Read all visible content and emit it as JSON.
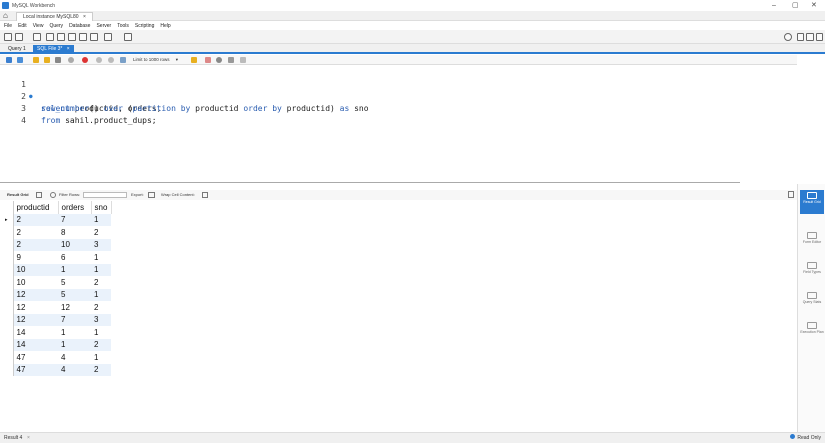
{
  "window": {
    "title": "MySQL Workbench",
    "minimize": "–",
    "maximize": "▢",
    "close": "✕"
  },
  "connection_tab": {
    "label": "Local instance MySQL80",
    "close": "×"
  },
  "menu": [
    "File",
    "Edit",
    "View",
    "Query",
    "Database",
    "Server",
    "Tools",
    "Scripting",
    "Help"
  ],
  "sql_tabs": [
    {
      "label": "Query 1",
      "active": false
    },
    {
      "label": "SQL File 3*",
      "active": true
    }
  ],
  "editor_toolbar": {
    "limit_label": "Limit to 1000 rows"
  },
  "editor": {
    "lines": [
      {
        "num": "1",
        "marker": "●",
        "tokens": [
          [
            "kw",
            "select"
          ],
          [
            "",
            "productid, orders,"
          ]
        ]
      },
      {
        "num": "2",
        "marker": "",
        "tokens": [
          [
            "kw",
            "row_number"
          ],
          [
            "",
            "() "
          ],
          [
            "kw",
            "over"
          ],
          [
            "",
            " ("
          ],
          [
            "kw",
            "partition by"
          ],
          [
            "",
            " productid "
          ],
          [
            "kw",
            "order by"
          ],
          [
            "",
            " productid) "
          ],
          [
            "kw",
            "as"
          ],
          [
            "",
            " sno"
          ]
        ]
      },
      {
        "num": "3",
        "marker": "",
        "tokens": [
          [
            "kw",
            "from"
          ],
          [
            "",
            " sahil.product_dups;"
          ]
        ]
      },
      {
        "num": "4",
        "marker": "",
        "tokens": []
      }
    ]
  },
  "result_toolbar": {
    "result_grid": "Result Grid",
    "filter_rows": "Filter Rows:",
    "export": "Export:",
    "wrap": "Wrap Cell Content:"
  },
  "grid": {
    "columns": [
      "productid",
      "orders",
      "sno"
    ],
    "rows": [
      [
        "2",
        "7",
        "1"
      ],
      [
        "2",
        "8",
        "2"
      ],
      [
        "2",
        "10",
        "3"
      ],
      [
        "9",
        "6",
        "1"
      ],
      [
        "10",
        "1",
        "1"
      ],
      [
        "10",
        "5",
        "2"
      ],
      [
        "12",
        "5",
        "1"
      ],
      [
        "12",
        "12",
        "2"
      ],
      [
        "12",
        "7",
        "3"
      ],
      [
        "14",
        "1",
        "1"
      ],
      [
        "14",
        "1",
        "2"
      ],
      [
        "47",
        "4",
        "1"
      ],
      [
        "47",
        "4",
        "2"
      ]
    ],
    "current_row_marker": "▸"
  },
  "right_panel": [
    {
      "label": "Result Grid",
      "active": true
    },
    {
      "label": "Form Editor",
      "active": false
    },
    {
      "label": "Field Types",
      "active": false
    },
    {
      "label": "Query Stats",
      "active": false
    },
    {
      "label": "Execution Plan",
      "active": false
    }
  ],
  "status": {
    "result_tab": "Result 4",
    "readonly": "Read Only"
  },
  "colors": {
    "accent": "#2b7bd0",
    "keyword": "#2a5db0"
  }
}
